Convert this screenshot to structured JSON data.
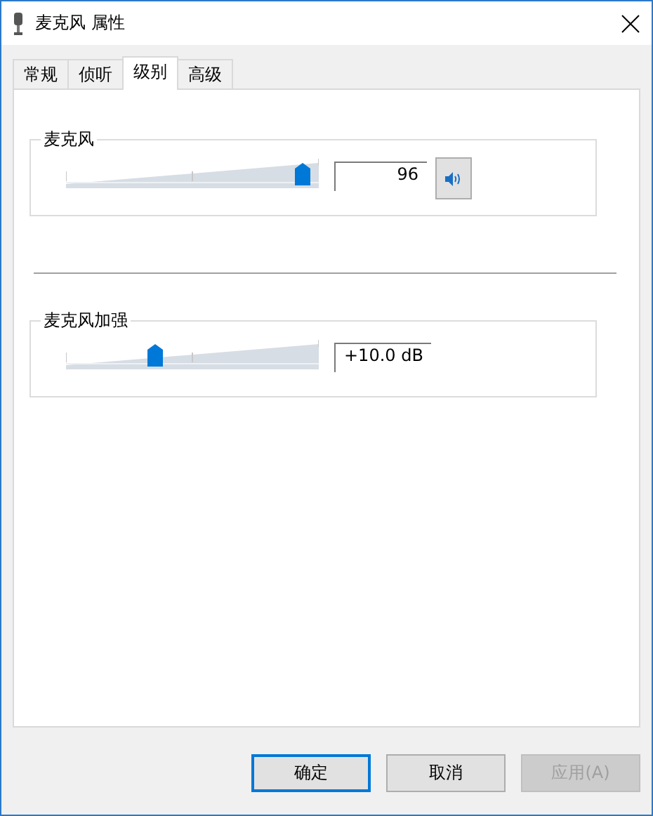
{
  "window": {
    "title": "麦克风 属性"
  },
  "tabs": [
    {
      "label": "常规",
      "selected": false
    },
    {
      "label": "侦听",
      "selected": false
    },
    {
      "label": "级别",
      "selected": true
    },
    {
      "label": "高级",
      "selected": false
    }
  ],
  "groups": [
    {
      "title": "麦克风",
      "level": 0.96,
      "value": "96",
      "speaker_button": true
    },
    {
      "title": "麦克风加强",
      "level": 0.34,
      "value": "+10.0 dB",
      "speaker_button": false
    }
  ],
  "buttons": [
    {
      "label": "确定",
      "default": true,
      "disabled": false
    },
    {
      "label": "取消",
      "default": false,
      "disabled": false
    },
    {
      "label": "应用(A)",
      "default": false,
      "disabled": true
    }
  ]
}
